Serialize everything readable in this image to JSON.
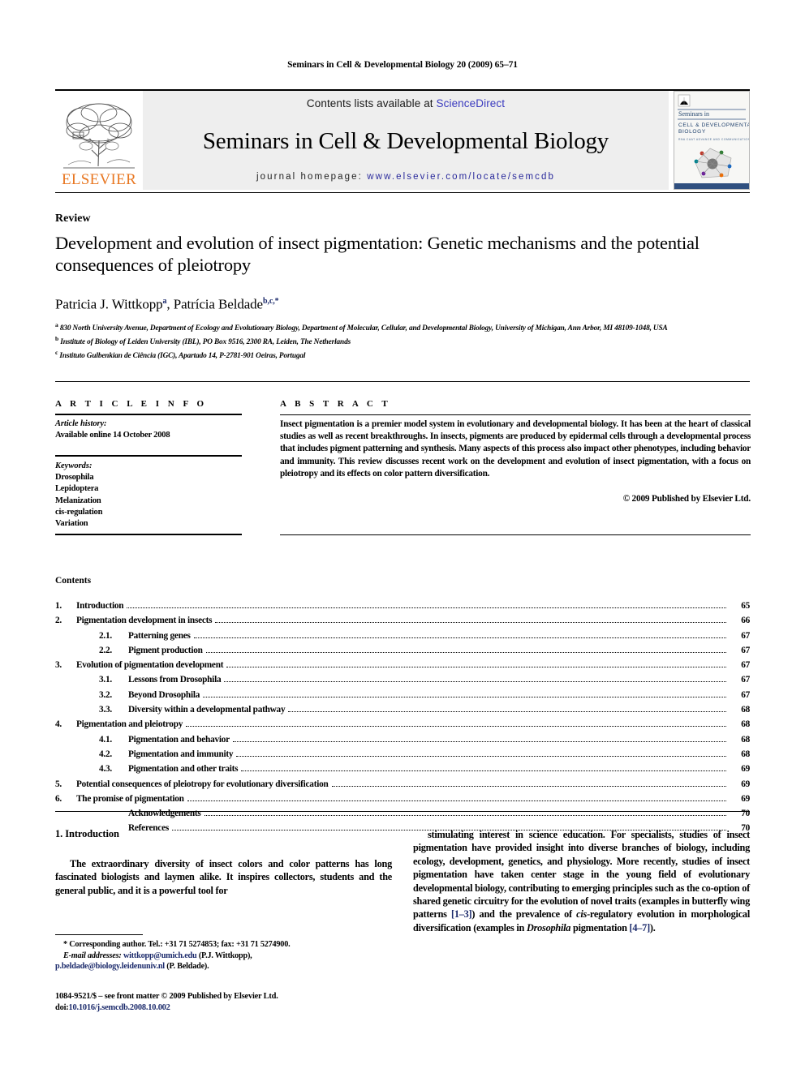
{
  "running_head": "Seminars in Cell & Developmental Biology 20 (2009) 65–71",
  "masthead": {
    "contents_prefix": "Contents lists available at ",
    "sciencedirect": "ScienceDirect",
    "journal_name": "Seminars in Cell & Developmental Biology",
    "homepage_prefix": "journal homepage: ",
    "homepage_url": "www.elsevier.com/locate/semcdb",
    "publisher_logo_text": "ELSEVIER",
    "publisher_logo_color": "#E87722",
    "link_color": "#3b3bbf",
    "band_bg": "#eeeeee",
    "cover": {
      "line1": "Seminars in",
      "line2": "CELL & DEVELOPMENTAL",
      "line3": "BIOLOGY",
      "line4": "RNA CAAT ADVANCE AND COMMUNICATION"
    }
  },
  "article": {
    "type_label": "Review",
    "title": "Development and evolution of insect pigmentation: Genetic mechanisms and the potential consequences of pleiotropy",
    "authors": [
      {
        "name": "Patricia J. Wittkopp",
        "sup": "a",
        "sep": ", "
      },
      {
        "name": "Patrícia Beldade",
        "sup": "b,c,",
        "star": "*",
        "sep": ""
      }
    ],
    "affiliations": [
      {
        "mark": "a",
        "text": "830 North University Avenue, Department of Ecology and Evolutionary Biology, Department of Molecular, Cellular, and Developmental Biology, University of Michigan, Ann Arbor, MI 48109-1048, USA"
      },
      {
        "mark": "b",
        "text": "Institute of Biology of Leiden University (IBL), PO Box 9516, 2300 RA, Leiden, The Netherlands"
      },
      {
        "mark": "c",
        "text": "Instituto Gulbenkian de Ciência (IGC), Apartado 14, P-2781-901 Oeiras, Portugal"
      }
    ]
  },
  "article_info": {
    "heading": "A R T I C L E    I N F O",
    "history_label": "Article history:",
    "history_value": "Available online 14 October 2008",
    "keywords_label": "Keywords:",
    "keywords": [
      "Drosophila",
      "Lepidoptera",
      "Melanization",
      "cis-regulation",
      "Variation"
    ]
  },
  "abstract": {
    "heading": "A B S T R A C T",
    "text": "Insect pigmentation is a premier model system in evolutionary and developmental biology. It has been at the heart of classical studies as well as recent breakthroughs. In insects, pigments are produced by epidermal cells through a developmental process that includes pigment patterning and synthesis. Many aspects of this process also impact other phenotypes, including behavior and immunity. This review discusses recent work on the development and evolution of insect pigmentation, with a focus on pleiotropy and its effects on color pattern diversification.",
    "copyright": "© 2009 Published by Elsevier Ltd."
  },
  "contents": {
    "title": "Contents",
    "entries": [
      {
        "num": "1.",
        "sub": "",
        "label": "Introduction",
        "page": "65",
        "level": 1
      },
      {
        "num": "2.",
        "sub": "",
        "label": "Pigmentation development in insects",
        "page": "66",
        "level": 1
      },
      {
        "num": "",
        "sub": "2.1.",
        "label": "Patterning genes",
        "page": "67",
        "level": 2
      },
      {
        "num": "",
        "sub": "2.2.",
        "label": "Pigment production",
        "page": "67",
        "level": 2
      },
      {
        "num": "3.",
        "sub": "",
        "label": "Evolution of pigmentation development",
        "page": "67",
        "level": 1
      },
      {
        "num": "",
        "sub": "3.1.",
        "label": "Lessons from Drosophila",
        "page": "67",
        "level": 2
      },
      {
        "num": "",
        "sub": "3.2.",
        "label": "Beyond Drosophila",
        "page": "67",
        "level": 2
      },
      {
        "num": "",
        "sub": "3.3.",
        "label": "Diversity within a developmental pathway",
        "page": "68",
        "level": 2
      },
      {
        "num": "4.",
        "sub": "",
        "label": "Pigmentation and pleiotropy",
        "page": "68",
        "level": 1
      },
      {
        "num": "",
        "sub": "4.1.",
        "label": "Pigmentation and behavior",
        "page": "68",
        "level": 2
      },
      {
        "num": "",
        "sub": "4.2.",
        "label": "Pigmentation and immunity",
        "page": "68",
        "level": 2
      },
      {
        "num": "",
        "sub": "4.3.",
        "label": "Pigmentation and other traits",
        "page": "69",
        "level": 2
      },
      {
        "num": "5.",
        "sub": "",
        "label": "Potential consequences of pleiotropy for evolutionary diversification",
        "page": "69",
        "level": 1
      },
      {
        "num": "6.",
        "sub": "",
        "label": "The promise of pigmentation",
        "page": "69",
        "level": 1
      },
      {
        "num": "",
        "sub": "",
        "label": "Acknowledgements",
        "page": "70",
        "level": 3
      },
      {
        "num": "",
        "sub": "",
        "label": "References",
        "page": "70",
        "level": 3
      }
    ]
  },
  "body": {
    "section1_heading": "1.  Introduction",
    "col_left_p1": "The extraordinary diversity of insect colors and color patterns has long fascinated biologists and laymen alike. It inspires collectors, students and the general public, and it is a powerful tool for",
    "col_right_p1_a": "stimulating interest in science education. For specialists, studies of insect pigmentation have provided insight into diverse branches of biology, including ecology, development, genetics, and physiology. More recently, studies of insect pigmentation have taken center stage in the young field of evolutionary developmental biology, contributing to emerging principles such as the co-option of shared genetic circuitry for the evolution of novel traits (examples in butterfly wing patterns ",
    "col_right_ref1": "[1–3]",
    "col_right_p1_b": ") and the prevalence of ",
    "col_right_italic1": "cis",
    "col_right_p1_c": "-regulatory evolution in morphological diversification (examples in ",
    "col_right_italic2": "Drosophila",
    "col_right_p1_d": " pigmentation ",
    "col_right_ref2": "[4–7]",
    "col_right_p1_e": ")."
  },
  "footnotes": {
    "corresponding": "*  Corresponding author. Tel.: +31 71 5274853; fax: +31 71 5274900.",
    "email_label": "E-mail addresses:",
    "email1": "wittkopp@umich.edu",
    "email1_owner": " (P.J. Wittkopp),",
    "email2": "p.beldade@biology.leidenuniv.nl",
    "email2_owner": " (P. Beldade)."
  },
  "imprint": {
    "issn_line": "1084-9521/$ – see front matter © 2009 Published by Elsevier Ltd.",
    "doi_label": "doi:",
    "doi_value": "10.1016/j.semcdb.2008.10.002"
  }
}
